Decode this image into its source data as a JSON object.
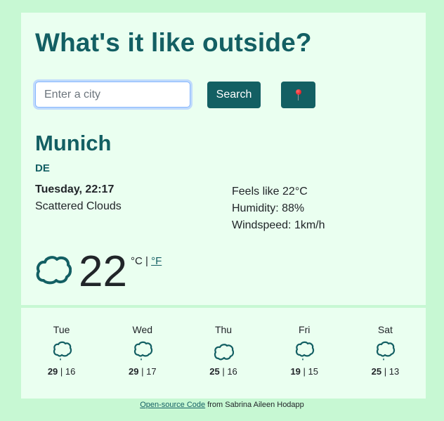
{
  "header": {
    "title": "What's it like outside?"
  },
  "search": {
    "placeholder": "Enter a city",
    "value": "",
    "search_label": "Search",
    "location_icon": "round-pushpin-icon"
  },
  "current": {
    "city": "Munich",
    "country": "DE",
    "datetime": "Tuesday, 22:17",
    "description": "Scattered Clouds",
    "feels_like": "Feels like 22°C",
    "humidity": "Humidity: 88%",
    "windspeed": "Windspeed: 1km/h",
    "icon": "cloud-icon",
    "temperature": "22",
    "unit_celsius": "°C",
    "unit_separator": " | ",
    "unit_fahrenheit": "°F"
  },
  "forecast": [
    {
      "day": "Tue",
      "icon": "cloud-rain-icon",
      "max": "29",
      "min": "16"
    },
    {
      "day": "Wed",
      "icon": "cloud-rain-icon",
      "max": "29",
      "min": "17"
    },
    {
      "day": "Thu",
      "icon": "cloud-icon",
      "max": "25",
      "min": "16"
    },
    {
      "day": "Fri",
      "icon": "cloud-rain-icon",
      "max": "19",
      "min": "15"
    },
    {
      "day": "Sat",
      "icon": "cloud-rain-icon",
      "max": "25",
      "min": "13"
    }
  ],
  "footer": {
    "link_text": "Open-source Code",
    "text": " from Sabrina Aileen Hodapp"
  },
  "colors": {
    "page_bg": "#c7f8d3",
    "card_bg": "#eafff0",
    "accent": "#135f63",
    "text": "#212529"
  }
}
